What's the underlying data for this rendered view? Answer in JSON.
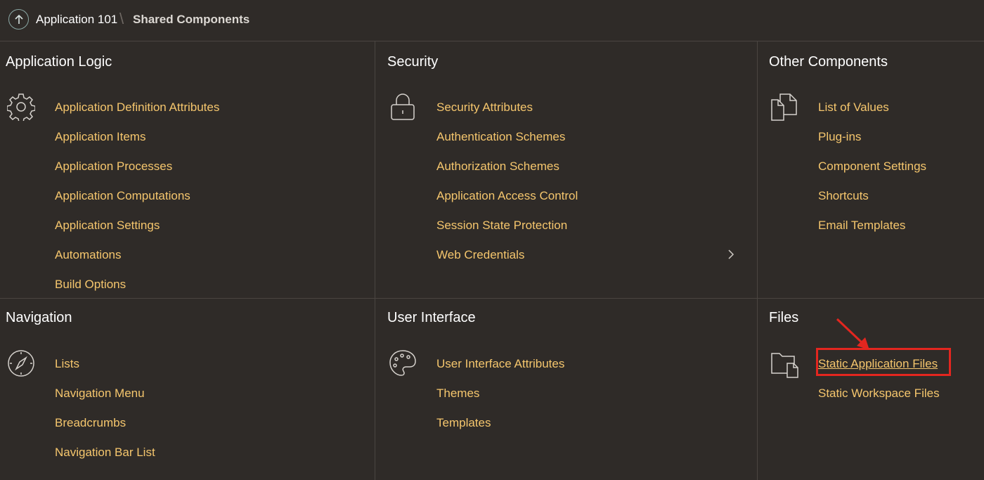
{
  "breadcrumb": {
    "app": "Application 101",
    "separator": "\\",
    "current": "Shared Components"
  },
  "panels": {
    "application_logic": {
      "title": "Application Logic",
      "icon": "gear-icon",
      "links": [
        "Application Definition Attributes",
        "Application Items",
        "Application Processes",
        "Application Computations",
        "Application Settings",
        "Automations",
        "Build Options"
      ]
    },
    "security": {
      "title": "Security",
      "icon": "lock-icon",
      "links": [
        "Security Attributes",
        "Authentication Schemes",
        "Authorization Schemes",
        "Application Access Control",
        "Session State Protection",
        "Web Credentials"
      ]
    },
    "other_components": {
      "title": "Other Components",
      "icon": "documents-icon",
      "links": [
        "List of Values",
        "Plug-ins",
        "Component Settings",
        "Shortcuts",
        "Email Templates"
      ]
    },
    "navigation": {
      "title": "Navigation",
      "icon": "compass-icon",
      "links": [
        "Lists",
        "Navigation Menu",
        "Breadcrumbs",
        "Navigation Bar List"
      ]
    },
    "user_interface": {
      "title": "User Interface",
      "icon": "palette-icon",
      "links": [
        "User Interface Attributes",
        "Themes",
        "Templates"
      ]
    },
    "files": {
      "title": "Files",
      "icon": "folder-file-icon",
      "links": [
        "Static Application Files",
        "Static Workspace Files"
      ]
    }
  },
  "colors": {
    "background": "#2f2b28",
    "link": "#f5c66d",
    "divider": "#4a4541",
    "highlight": "#e3261f"
  }
}
